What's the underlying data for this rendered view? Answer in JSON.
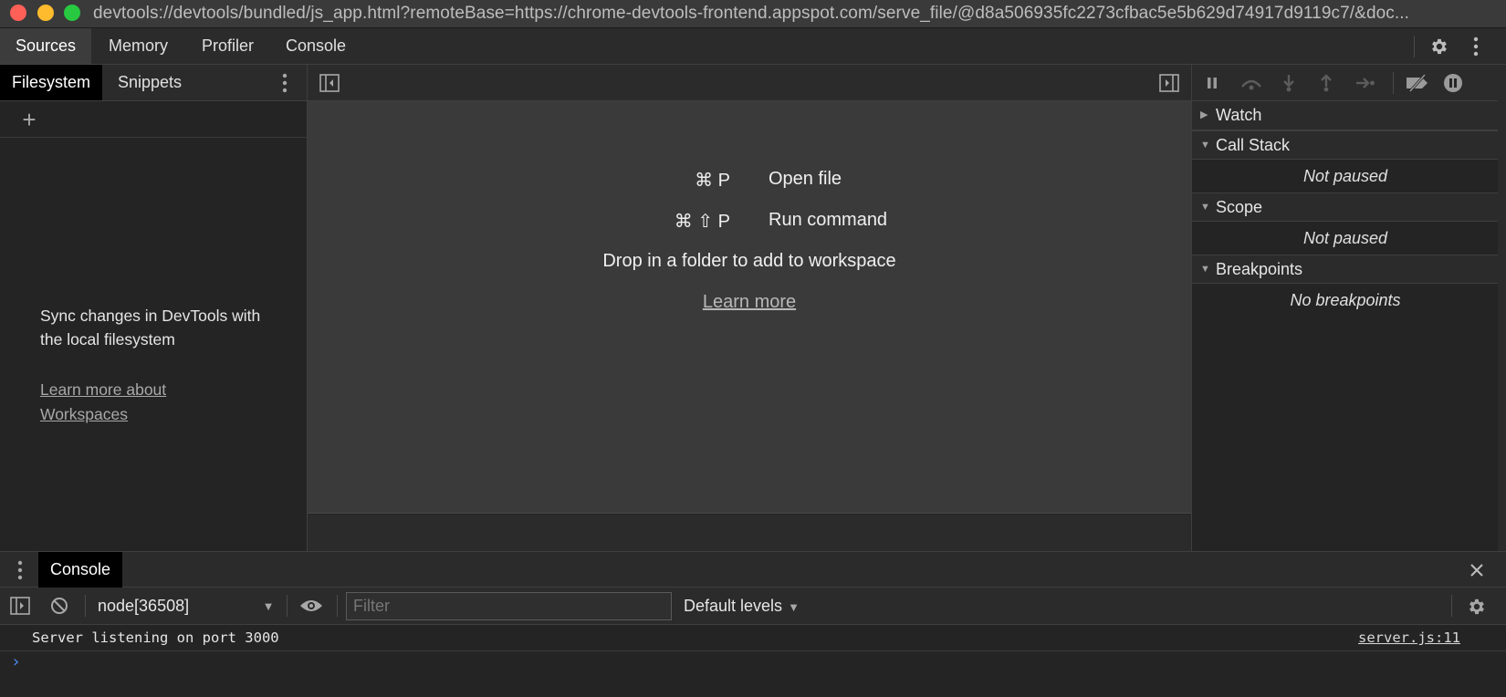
{
  "window": {
    "title": "devtools://devtools/bundled/js_app.html?remoteBase=https://chrome-devtools-frontend.appspot.com/serve_file/@d8a506935fc2273cfbac5e5b629d74917d9119c7/&doc..."
  },
  "main_tabs": [
    {
      "label": "Sources",
      "active": true
    },
    {
      "label": "Memory",
      "active": false
    },
    {
      "label": "Profiler",
      "active": false
    },
    {
      "label": "Console",
      "active": false
    }
  ],
  "navigator": {
    "tabs": [
      {
        "label": "Filesystem",
        "active": true
      },
      {
        "label": "Snippets",
        "active": false
      }
    ],
    "add_label": "+",
    "sync_text": "Sync changes in DevTools with the local filesystem",
    "learn_more": "Learn more about Workspaces"
  },
  "editor": {
    "shortcuts": [
      {
        "keys": "⌘ P",
        "label": "Open file"
      },
      {
        "keys": "⌘ ⇧ P",
        "label": "Run command"
      }
    ],
    "drop_text": "Drop in a folder to add to workspace",
    "learn_more": "Learn more"
  },
  "debugger": {
    "sections": [
      {
        "label": "Watch",
        "expanded": false,
        "body": ""
      },
      {
        "label": "Call Stack",
        "expanded": true,
        "body": "Not paused"
      },
      {
        "label": "Scope",
        "expanded": true,
        "body": "Not paused"
      },
      {
        "label": "Breakpoints",
        "expanded": true,
        "body": "No breakpoints"
      }
    ]
  },
  "drawer": {
    "tab": "Console",
    "context": "node[36508]",
    "filter_placeholder": "Filter",
    "levels": "Default levels",
    "messages": [
      {
        "text": "Server listening on port 3000",
        "source": "server.js:11"
      }
    ],
    "prompt": "›"
  },
  "colors": {
    "accent_prompt": "#4d8cf5",
    "traffic_red": "#fe5f57",
    "traffic_yellow": "#febb2e",
    "traffic_green": "#28c840"
  }
}
